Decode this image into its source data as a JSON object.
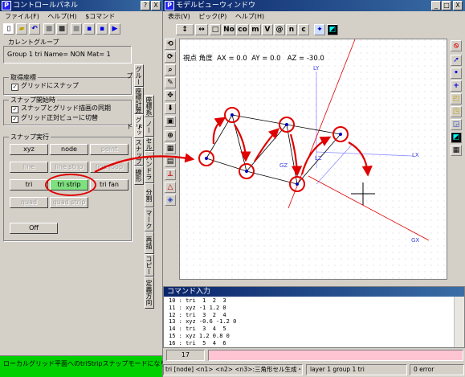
{
  "control_panel": {
    "title": "コントロールパネル",
    "menu": [
      "ファイル(F)",
      "ヘルプ(H)",
      "$コマンド"
    ],
    "title_buttons": [
      "?",
      "X"
    ],
    "current_group_label": "カレントグループ",
    "current_group_value": "Group 1 tri Name= NON Mat= 1",
    "acquire_coords_label": "取得座標",
    "grid_snap_label": "グリッドにスナップ",
    "snap_start_label": "スナップ開始時",
    "sync_label": "スナップとグリッド描画の同期",
    "grid_view_label": "グリッド正対ビューに切替",
    "snap_exec_label": "スナップ実行",
    "snap_buttons": [
      {
        "label": "xyz",
        "state": "enabled"
      },
      {
        "label": "node",
        "state": "enabled"
      },
      {
        "label": "point",
        "state": "disabled"
      },
      {
        "label": "line",
        "state": "disabled"
      },
      {
        "label": "line strip",
        "state": "disabled"
      },
      {
        "label": "line loop",
        "state": "disabled"
      },
      {
        "label": "tri",
        "state": "enabled"
      },
      {
        "label": "tri strip",
        "state": "selected"
      },
      {
        "label": "tri fan",
        "state": "enabled"
      },
      {
        "label": "quad",
        "state": "disabled"
      },
      {
        "label": "quad strip",
        "state": "disabled"
      }
    ],
    "off_label": "Off",
    "side_tabs_a": [
      "グループ",
      "座標計算",
      "グリッド"
    ],
    "side_tabs_b": [
      "座標系",
      "ノード",
      "セル",
      "スナップ",
      "ハンドラー"
    ],
    "side_tabs_c": [
      "分割",
      "マーク",
      "再描",
      "コピー",
      "定義方向"
    ],
    "side_tabs_d": [
      "線形"
    ]
  },
  "model_view": {
    "title": "モデルビューウィンドウ",
    "menu": [
      "表示(V)",
      "ピック(P)",
      "ヘルプ(H)"
    ],
    "title_buttons": [
      "_",
      "□",
      "X"
    ],
    "toolbar_items": [
      "↕",
      "↔",
      "□",
      "No",
      "co",
      "m",
      "V",
      "@",
      "n",
      "c"
    ],
    "view_info": "視点 角度  AX = 0.0  AY = 0.0   AZ = -30.0",
    "axis_labels": {
      "ly": "LY",
      "lx": "LX",
      "lz": "LZ",
      "gz": "GZ",
      "gx": "GX"
    }
  },
  "command_window": {
    "title": "コマンド入力",
    "lines": [
      "10 : tri  1  2  3",
      "11 : xyz -1 1.2 0",
      "12 : tri  3  2  4",
      "13 : xyz -0.6 -1.2 0",
      "14 : tri  3  4  5",
      "15 : xyz 1.2 0.8 0",
      "16 : tri  5  4  6"
    ],
    "counter": "17"
  },
  "status": {
    "message": "ローカルグリッド平面へのtriStripスナップモードになりました。",
    "command_hint": "tri [node] <n1> <n2> <n3>:三角形セル生成・変更",
    "layer_info": "layer 1 group 1 tri",
    "error_info": "0 error"
  },
  "colors": {
    "accent_red": "#e00000",
    "selected_green": "#7fe07f",
    "status_green": "#00d000",
    "title_blue": "#0a246a",
    "input_pink": "#ffc4d2"
  }
}
